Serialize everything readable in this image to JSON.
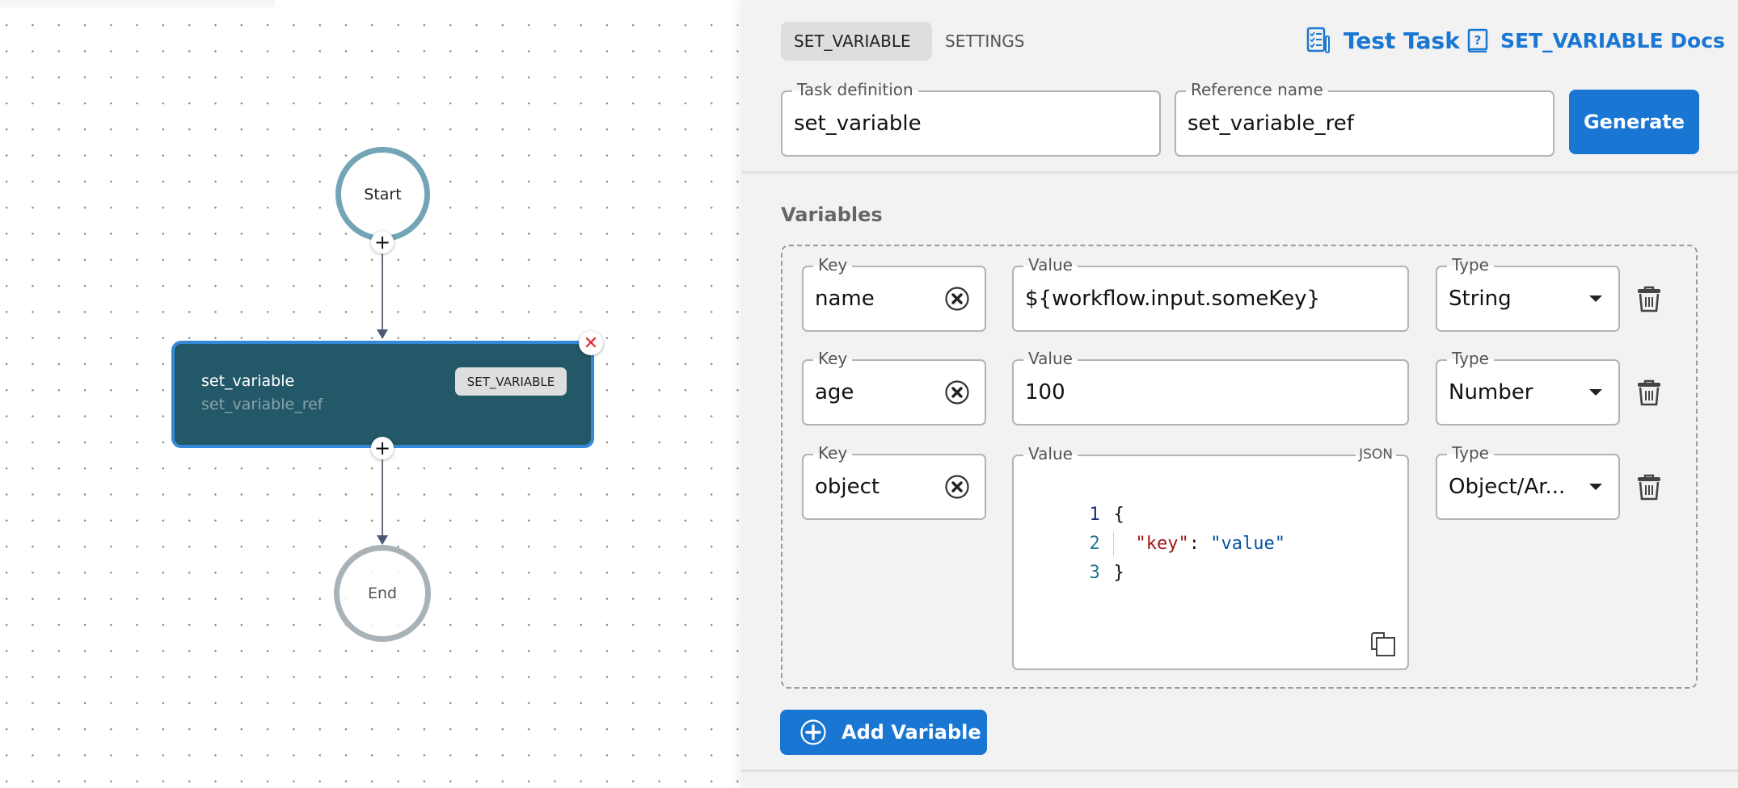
{
  "canvas": {
    "start_label": "Start",
    "end_label": "End",
    "task_node": {
      "name": "set_variable",
      "reference": "set_variable_ref",
      "type_badge": "SET_VARIABLE"
    },
    "colors": {
      "task_bg": "#235868",
      "task_border": "#3589d8",
      "start_border": "#74a5b5",
      "end_border": "#a9b3b7",
      "close_icon": "#e0282d"
    }
  },
  "panel": {
    "tabs": [
      {
        "label": "SET_VARIABLE",
        "active": true
      },
      {
        "label": "SETTINGS",
        "active": false
      }
    ],
    "test_task_label": "Test Task",
    "docs_label": "SET_VARIABLE Docs",
    "task_definition": {
      "label": "Task definition",
      "value": "set_variable"
    },
    "reference_name": {
      "label": "Reference name",
      "value": "set_variable_ref"
    },
    "generate_label": "Generate",
    "variables_heading": "Variables",
    "variables": [
      {
        "key_label": "Key",
        "key": "name",
        "value_label": "Value",
        "value": "${workflow.input.someKey}",
        "type_label": "Type",
        "type": "String"
      },
      {
        "key_label": "Key",
        "key": "age",
        "value_label": "Value",
        "value": "100",
        "type_label": "Type",
        "type": "Number"
      },
      {
        "key_label": "Key",
        "key": "object",
        "value_label": "Value",
        "value_mode": "JSON",
        "code_lines": [
          {
            "num": "1",
            "text": "{"
          },
          {
            "num": "2",
            "key": "\"key\"",
            "sep": ": ",
            "val": "\"value\""
          },
          {
            "num": "3",
            "text": "}"
          }
        ],
        "type_label": "Type",
        "type": "Object/Ar..."
      }
    ],
    "add_variable_label": "Add Variable",
    "accent_color": "#1976d2"
  }
}
